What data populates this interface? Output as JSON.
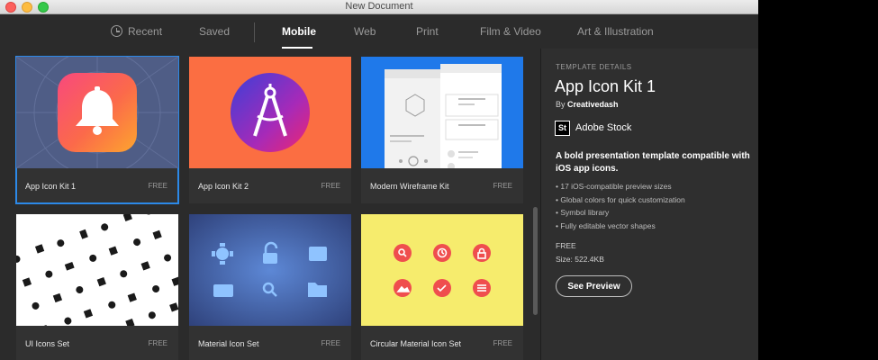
{
  "window": {
    "title": "New Document"
  },
  "tabs": [
    {
      "label": "Recent",
      "icon": "clock-icon"
    },
    {
      "label": "Saved"
    },
    {
      "label": "Mobile",
      "active": true
    },
    {
      "label": "Web"
    },
    {
      "label": "Print"
    },
    {
      "label": "Film & Video"
    },
    {
      "label": "Art & Illustration"
    }
  ],
  "templates": [
    {
      "name": "App Icon Kit 1",
      "price": "FREE",
      "selected": true
    },
    {
      "name": "App Icon Kit 2",
      "price": "FREE"
    },
    {
      "name": "Modern Wireframe Kit",
      "price": "FREE"
    },
    {
      "name": "UI Icons Set",
      "price": "FREE"
    },
    {
      "name": "Material Icon Set",
      "price": "FREE"
    },
    {
      "name": "Circular Material Icon Set",
      "price": "FREE"
    }
  ],
  "details": {
    "section_label": "TEMPLATE DETAILS",
    "title": "App Icon Kit 1",
    "by_prefix": "By",
    "author": "Creativedash",
    "stock_logo": "St",
    "stock_name": "Adobe Stock",
    "description": "A bold presentation template compatible with iOS app icons.",
    "features": [
      "17 iOS-compatible preview sizes",
      "Global colors for quick customization",
      "Symbol library",
      "Fully editable vector shapes"
    ],
    "price": "FREE",
    "size": "Size: 522.4KB",
    "preview_button": "See Preview"
  },
  "colors": {
    "accent": "#2c89e8",
    "window_bg": "#2b2b2b",
    "panel_bg": "#2f2f2f"
  }
}
